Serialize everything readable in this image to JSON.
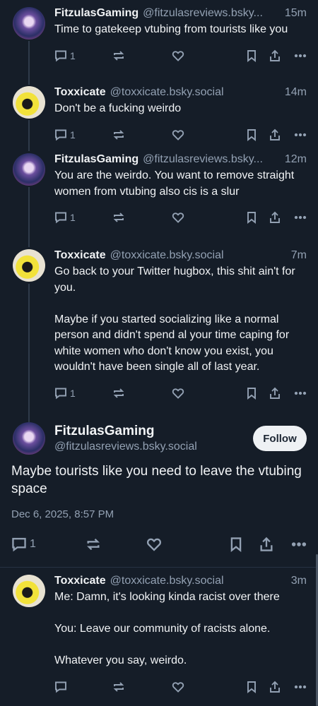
{
  "posts": [
    {
      "name": "FitzulasGaming",
      "handle": "@fitzulasreviews.bsky...",
      "time": "15m",
      "text": "Time to gatekeep vtubing from tourists like you",
      "replies": "1",
      "avatar": "fitzulas-avatar"
    },
    {
      "name": "Toxxicate",
      "handle": "@toxxicate.bsky.social",
      "time": "14m",
      "text": "Don't be a fucking weirdo",
      "replies": "1",
      "avatar": "toxxicate-avatar"
    },
    {
      "name": "FitzulasGaming",
      "handle": "@fitzulasreviews.bsky...",
      "time": "12m",
      "text": "You are the weirdo. You want to remove straight women from vtubing also cis is a slur",
      "replies": "1",
      "avatar": "fitzulas-avatar"
    },
    {
      "name": "Toxxicate",
      "handle": "@toxxicate.bsky.social",
      "time": "7m",
      "text": "Go back to your Twitter hugbox, this shit ain't for you.\n\nMaybe if you started socializing like a normal person and didn't spend al your time caping for white women who don't know you exist, you wouldn't have been single all of last year.",
      "replies": "1",
      "avatar": "toxxicate-avatar"
    }
  ],
  "main_post": {
    "name": "FitzulasGaming",
    "handle": "@fitzulasreviews.bsky.social",
    "follow_label": "Follow",
    "text": "Maybe tourists like you need to leave the vtubing space",
    "date": "Dec 6, 2025, 8:57 PM",
    "replies": "1"
  },
  "reply": {
    "name": "Toxxicate",
    "handle": "@toxxicate.bsky.social",
    "time": "3m",
    "text": "Me: Damn, it's looking kinda racist over there\n\nYou: Leave our community of racists alone.\n\nWhatever you say, weirdo.",
    "replies": ""
  },
  "icons": [
    "reply-icon",
    "repost-icon",
    "like-icon",
    "bookmark-icon",
    "share-icon",
    "more-icon"
  ],
  "colors": {
    "background": "#151d28",
    "muted": "#93a1b3",
    "text": "#f1f3f5",
    "follow_bg": "#eef1f4"
  }
}
